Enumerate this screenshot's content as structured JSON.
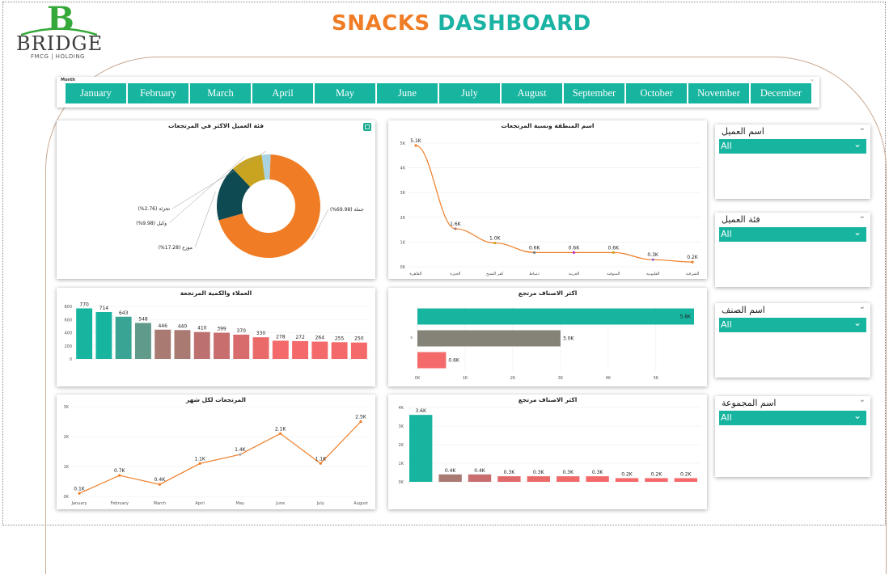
{
  "brand": {
    "letter": "B",
    "name": "BRIDGE",
    "tagline": "FMCG | HOLDING"
  },
  "title": {
    "part1": "SNACKS",
    "part2": "DASHBOARD"
  },
  "colors": {
    "teal": "#17b4a0",
    "orange": "#f07d25",
    "dark": "#0e4a52",
    "mustard": "#c9a420",
    "light_blue": "#a9d3e0",
    "grey": "#858377",
    "mauve": "#a97a72",
    "coral": "#f46a6a",
    "line_orange": "#f07d25"
  },
  "month_slicer": {
    "label": "Month",
    "months": [
      "January",
      "February",
      "March",
      "April",
      "May",
      "June",
      "July",
      "August",
      "September",
      "October",
      "November",
      "December"
    ]
  },
  "slicers": [
    {
      "label": "اسم العميل",
      "value": "All"
    },
    {
      "label": "فئة العميل",
      "value": "All"
    },
    {
      "label": "اسم الصنف",
      "value": "All"
    },
    {
      "label": "اسم المجموعة",
      "value": "All"
    }
  ],
  "chart_data": [
    {
      "type": "pie",
      "title": "فئة العميل الاكثر في المرتجعات",
      "slices": [
        {
          "label": "جملة",
          "value": 69.98,
          "text": "جملة (69.98%)",
          "color": "#f07d25"
        },
        {
          "label": "موزع",
          "value": 17.28,
          "text": "موزع (17.28%)",
          "color": "#0e4a52"
        },
        {
          "label": "وكيل",
          "value": 9.98,
          "text": "وكيل (9.98%)",
          "color": "#c9a420"
        },
        {
          "label": "تجزئة",
          "value": 2.76,
          "text": "تجزئة (2.76%)",
          "color": "#a9d3e0"
        }
      ]
    },
    {
      "type": "line",
      "title": "اسم المنطقة ونسبة المرتجعات",
      "categories": [
        "القاهرة",
        "الجيزة",
        "كفر الشيخ",
        "دمياط",
        "الغربية",
        "المنوفية",
        "القليوبية",
        "الشرقية"
      ],
      "values": [
        5.1,
        1.6,
        1.0,
        0.6,
        0.6,
        0.6,
        0.3,
        0.2
      ],
      "labels": [
        "5.1K",
        "1.6K",
        "1.0K",
        "0.6K",
        "0.6K",
        "0.6K",
        "0.3K",
        "0.2K"
      ],
      "yticks": [
        "0K",
        "1K",
        "2K",
        "3K",
        "4K",
        "5K"
      ],
      "ylim": [
        0,
        5.2
      ]
    },
    {
      "type": "bar",
      "title": "العملاء والكمية المرتجعة",
      "values": [
        770,
        714,
        643,
        548,
        446,
        440,
        410,
        399,
        370,
        330,
        278,
        272,
        264,
        255,
        250
      ],
      "colors": [
        "#17b4a0",
        "#17b4a0",
        "#3aa494",
        "#5f9a8a",
        "#a97a72",
        "#a97a72",
        "#bd7070",
        "#c86e6e",
        "#d86b6b",
        "#ea6a6a",
        "#f46a6a",
        "#f46a6a",
        "#f46a6a",
        "#f46a6a",
        "#f46a6a"
      ],
      "yticks": [
        "0",
        "200",
        "400",
        "600",
        "800"
      ],
      "ylim": [
        0,
        800
      ]
    },
    {
      "type": "bar",
      "orientation": "horizontal",
      "title": "اكثر الاصناف مرتجع",
      "values": [
        5.8,
        3.0,
        0.6
      ],
      "labels": [
        "5.8K",
        "3.0K",
        "0.6K"
      ],
      "colors": [
        "#17b4a0",
        "#858377",
        "#f46a6a"
      ],
      "category_label": "s",
      "xticks": [
        "0K",
        "1K",
        "2K",
        "3K",
        "4K",
        "5K"
      ],
      "xlim": [
        0,
        5.8
      ]
    },
    {
      "type": "line",
      "title": "المرتجعات لكل شهر",
      "categories": [
        "January",
        "February",
        "March",
        "April",
        "May",
        "June",
        "July",
        "August"
      ],
      "values": [
        0.1,
        0.7,
        0.4,
        1.1,
        1.4,
        2.1,
        1.1,
        2.5
      ],
      "labels": [
        "0.1K",
        "0.7K",
        "0.4K",
        "1.1K",
        "1.4K",
        "2.1K",
        "1.1K",
        "2.5K"
      ],
      "yticks": [
        "0K",
        "1K",
        "2K",
        "3K"
      ],
      "ylim": [
        0,
        3
      ]
    },
    {
      "type": "bar",
      "title": "اكثر الاصناف مرتجع",
      "values": [
        3.6,
        0.4,
        0.4,
        0.3,
        0.3,
        0.3,
        0.3,
        0.2,
        0.2,
        0.2
      ],
      "labels": [
        "3.6K",
        "0.4K",
        "0.4K",
        "0.3K",
        "0.3K",
        "0.3K",
        "0.3K",
        "0.2K",
        "0.2K",
        "0.2K"
      ],
      "colors": [
        "#17b4a0",
        "#a97a72",
        "#c86e6e",
        "#e06a6a",
        "#ea6a6a",
        "#f06a6a",
        "#f46a6a",
        "#f46a6a",
        "#f46a6a",
        "#f46a6a"
      ],
      "yticks": [
        "0K",
        "1K",
        "2K",
        "3K",
        "4K"
      ],
      "ylim": [
        0,
        4
      ]
    }
  ]
}
